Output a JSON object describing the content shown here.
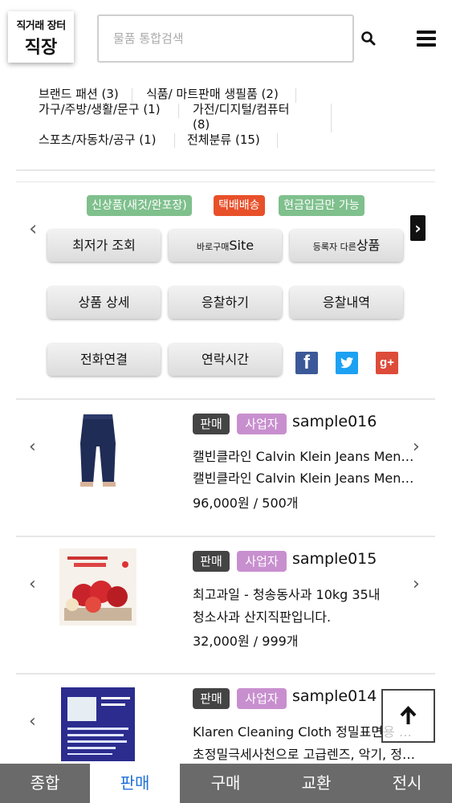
{
  "header": {
    "logo_sub": "직거래 장터",
    "logo_main": "직장",
    "search_placeholder": "물품 통합검색"
  },
  "categories": [
    {
      "label": "브랜드 패션 (3)"
    },
    {
      "label": "식품/ 마트판매 생필품 (2)"
    },
    {
      "label": "가구/주방/생활/문구 (1)"
    },
    {
      "label": "가전/디지털/컴퓨터"
    },
    {
      "label": "(8)"
    },
    {
      "label": "스포츠/자동차/공구 (1)"
    },
    {
      "label": "전체분류 (15)"
    }
  ],
  "tags": [
    "신상품(새것/완포장)",
    "택배배송",
    "현금입금만 가능"
  ],
  "buttons": {
    "lowest": "최저가 조회",
    "direct_small": "바로구매",
    "direct_big": "Site",
    "other_small": "등록자 다른",
    "other_big": "상품",
    "detail": "상품 상세",
    "bid": "응찰하기",
    "bid_history": "응찰내역",
    "call": "전화연결",
    "contact_time": "연락시간"
  },
  "social": {
    "fb": "f",
    "gp": "g+"
  },
  "products": [
    {
      "type": "판매",
      "biz": "사업자",
      "seller": "sample016",
      "title1": "캘빈클라인 Calvin Klein Jeans Men…",
      "title2": "캘빈클라인 Calvin Klein Jeans Men…",
      "price": "96,000원 / 500개"
    },
    {
      "type": "판매",
      "biz": "사업자",
      "seller": "sample015",
      "title1": "최고과일 - 청송동사과 10kg 35내",
      "title2": "청소사과 산지직판입니다.",
      "price": "32,000원 / 999개"
    },
    {
      "type": "판매",
      "biz": "사업자",
      "seller": "sample014",
      "title1": "Klaren Cleaning Cloth 정밀표면용 …",
      "title2": "초정밀극세사천으로 고급렌즈, 악기, 정…",
      "price": ""
    }
  ],
  "bottom_nav": [
    "종합",
    "판매",
    "구매",
    "교환",
    "전시"
  ],
  "active_nav": "판매"
}
